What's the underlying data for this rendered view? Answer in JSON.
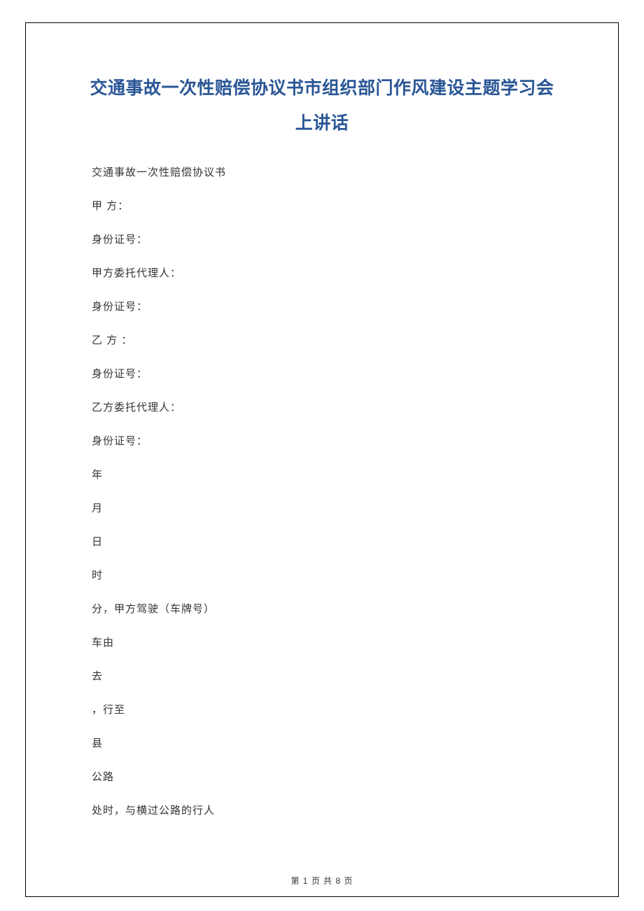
{
  "title": "交通事故一次性赔偿协议书市组织部门作风建设主题学习会上讲话",
  "lines": [
    "交通事故一次性赔偿协议书",
    " 甲 方：",
    "身份证号：",
    "甲方委托代理人：",
    " 身份证号：",
    "乙 方 ：",
    " 身份证号：",
    "乙方委托代理人：",
    " 身份证号：",
    " 年",
    "月",
    "日",
    "时",
    "分，甲方驾驶（车牌号）",
    "  车由",
    "去",
    " ，行至",
    "  县",
    "公路",
    "处时，与横过公路的行人"
  ],
  "footer": {
    "prefix": "第 ",
    "current": "1",
    "middle": " 页   共 ",
    "total": "8",
    "suffix": " 页"
  }
}
